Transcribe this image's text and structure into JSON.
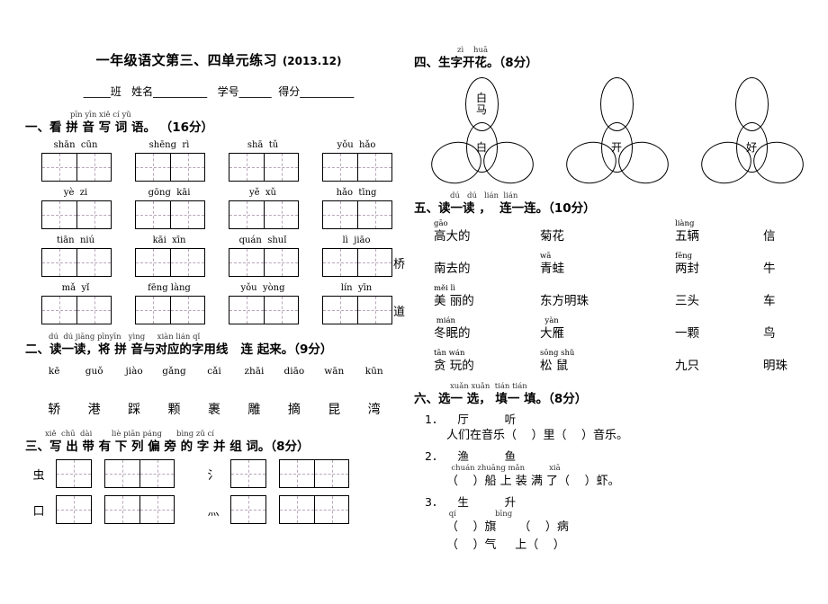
{
  "header": {
    "title": "一年级语文第三、四单元练习",
    "date": "(2013.12)",
    "info_line": "_____班   姓名__________   学号______  得分__________"
  },
  "section1": {
    "pinyin": "pīn yīn xiě cí yǔ",
    "title": "一、看 拼 音 写 词 语。 （16分）",
    "rows": [
      {
        "cells": [
          {
            "py": "shān  cūn",
            "cells": 2,
            "tail": ""
          },
          {
            "py": "shēng  rì",
            "cells": 2,
            "tail": ""
          },
          {
            "py": "shā  tǔ",
            "cells": 2,
            "tail": ""
          },
          {
            "py": "yǒu  hǎo",
            "cells": 2,
            "tail": ""
          }
        ]
      },
      {
        "cells": [
          {
            "py": "yè  zi",
            "cells": 2,
            "tail": ""
          },
          {
            "py": "gōng  kāi",
            "cells": 2,
            "tail": ""
          },
          {
            "py": "yě  xǔ",
            "cells": 2,
            "tail": ""
          },
          {
            "py": "hǎo  tīng",
            "cells": 2,
            "tail": ""
          }
        ]
      },
      {
        "cells": [
          {
            "py": "tiān  niú",
            "cells": 2,
            "tail": ""
          },
          {
            "py": "kāi  xīn",
            "cells": 2,
            "tail": ""
          },
          {
            "py": "quán  shuǐ",
            "cells": 2,
            "tail": ""
          },
          {
            "py": "lì  jiāo",
            "cells": 2,
            "tail": "桥"
          }
        ]
      },
      {
        "cells": [
          {
            "py": "mǎ  yǐ",
            "cells": 2,
            "tail": ""
          },
          {
            "py": "fēng làng",
            "cells": 2,
            "tail": ""
          },
          {
            "py": "yǒu  yòng",
            "cells": 2,
            "tail": ""
          },
          {
            "py": "lín  yīn",
            "cells": 2,
            "tail": "道"
          }
        ]
      }
    ]
  },
  "section2": {
    "pinyin": "dú  dú jiāng pīnyīn   yìng     xiàn lián qǐ",
    "title": "二、读一读，将 拼 音与对应的字用线   连 起来。（9分）",
    "pinyin_items": [
      "kē",
      "guǒ",
      "jiào",
      "gǎng",
      "cǎi",
      "zhāi",
      "diāo",
      "wān",
      "kūn"
    ],
    "char_items": [
      "轿",
      "港",
      "踩",
      "颗",
      "裹",
      "雕",
      "摘",
      "昆",
      "湾"
    ]
  },
  "section3": {
    "pinyin": "xiě  chū  dài        liè piān páng      bìng zǔ cí",
    "title": "三、写 出 带 有 下 列 偏 旁 的 字 并 组 词。（8分）",
    "rows": [
      {
        "left_radical": "虫",
        "right_radical": "氵"
      },
      {
        "left_radical": "口",
        "right_radical": "灬"
      }
    ]
  },
  "section4": {
    "pinyin": "zì    huā",
    "title": "四、生字开花。（8分）",
    "flowers": [
      {
        "center": "白",
        "top": "白\n马",
        "bl": "",
        "br": ""
      },
      {
        "center": "开",
        "top": "",
        "bl": "",
        "br": ""
      },
      {
        "center": "好",
        "top": "",
        "bl": "",
        "br": ""
      }
    ]
  },
  "section5": {
    "pinyin": "dú   dú   lián  lián",
    "title": "五、读一读 ，  连一连。（10分）",
    "rows": [
      {
        "c1_py": "gāo",
        "c1": "高大的",
        "c2_py": "",
        "c2": "菊花",
        "c3_py": "liàng",
        "c3": "五辆",
        "c4_py": "",
        "c4": "信"
      },
      {
        "c1_py": "",
        "c1": "南去的",
        "c2_py": "wā",
        "c2": "青蛙",
        "c3_py": "fēng",
        "c3": "两封",
        "c4_py": "",
        "c4": "牛"
      },
      {
        "c1_py": "měi lì",
        "c1": "美 丽的",
        "c2_py": "",
        "c2": "东方明珠",
        "c3_py": "",
        "c3": "三头",
        "c4_py": "",
        "c4": "车"
      },
      {
        "c1_py": " mián",
        "c1": "冬眠的",
        "c2_py": "  yàn",
        "c2": "大雁",
        "c3_py": "",
        "c3": "一颗",
        "c4_py": "",
        "c4": "鸟"
      },
      {
        "c1_py": "tān wán",
        "c1": "贪 玩的",
        "c2_py": "sōng shǔ",
        "c2": "松 鼠",
        "c3_py": "",
        "c3": "九只",
        "c4_py": "",
        "c4": "明珠"
      }
    ]
  },
  "section6": {
    "pinyin": "xuǎn xuǎn  tián tián",
    "title": "六、选一 选， 填一 填。（8分）",
    "items": [
      {
        "num": "1．",
        "head": "厅          听",
        "lines": [
          {
            "py": "",
            "text": "人们在音乐（    ）里（    ）音乐。"
          }
        ]
      },
      {
        "num": "2．",
        "head": "渔          鱼",
        "lines": [
          {
            "py": "  chuán zhuāng mǎn          xiā",
            "text": "（    ）船 上 装 满 了（    ）虾。"
          }
        ]
      },
      {
        "num": "3．",
        "head": "生          升",
        "lines": [
          {
            "py": " qí                bīng",
            "text": "（    ）旗      （    ）病"
          },
          {
            "py": "",
            "text": "（    ）气     上（    ）"
          }
        ]
      }
    ]
  }
}
